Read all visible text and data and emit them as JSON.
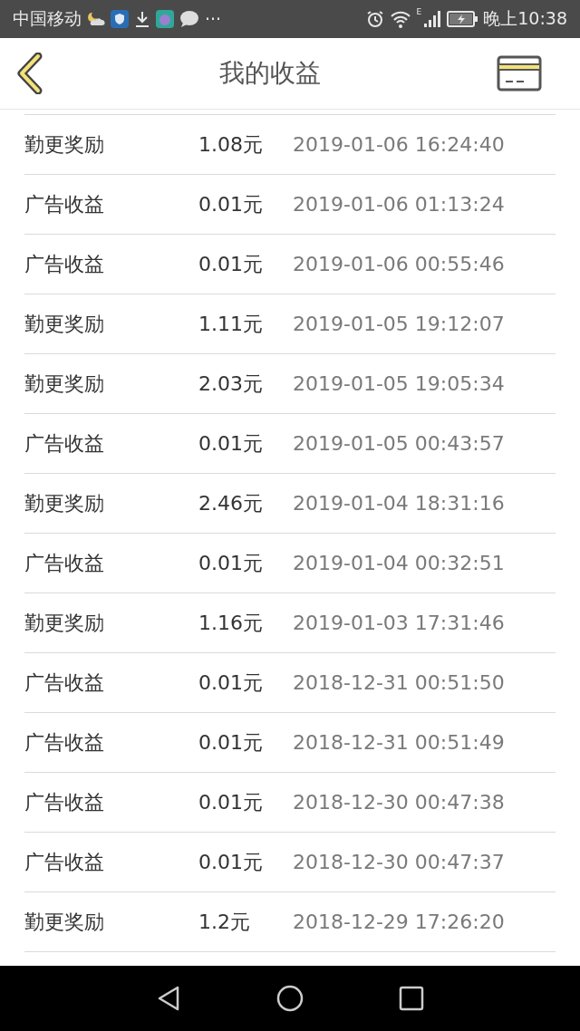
{
  "status_bar": {
    "carrier": "中国移动",
    "more": "···",
    "network": "E",
    "time": "晚上10:38"
  },
  "header": {
    "title": "我的收益"
  },
  "rows": [
    {
      "type": "勤更奖励",
      "amount": "1.08元",
      "time": "2019-01-06 16:24:40"
    },
    {
      "type": "广告收益",
      "amount": "0.01元",
      "time": "2019-01-06 01:13:24"
    },
    {
      "type": "广告收益",
      "amount": "0.01元",
      "time": "2019-01-06 00:55:46"
    },
    {
      "type": "勤更奖励",
      "amount": "1.11元",
      "time": "2019-01-05 19:12:07"
    },
    {
      "type": "勤更奖励",
      "amount": "2.03元",
      "time": "2019-01-05 19:05:34"
    },
    {
      "type": "广告收益",
      "amount": "0.01元",
      "time": "2019-01-05 00:43:57"
    },
    {
      "type": "勤更奖励",
      "amount": "2.46元",
      "time": "2019-01-04 18:31:16"
    },
    {
      "type": "广告收益",
      "amount": "0.01元",
      "time": "2019-01-04 00:32:51"
    },
    {
      "type": "勤更奖励",
      "amount": "1.16元",
      "time": "2019-01-03 17:31:46"
    },
    {
      "type": "广告收益",
      "amount": "0.01元",
      "time": "2018-12-31 00:51:50"
    },
    {
      "type": "广告收益",
      "amount": "0.01元",
      "time": "2018-12-31 00:51:49"
    },
    {
      "type": "广告收益",
      "amount": "0.01元",
      "time": "2018-12-30 00:47:38"
    },
    {
      "type": "广告收益",
      "amount": "0.01元",
      "time": "2018-12-30 00:47:37"
    },
    {
      "type": "勤更奖励",
      "amount": "1.2元",
      "time": "2018-12-29 17:26:20"
    }
  ]
}
